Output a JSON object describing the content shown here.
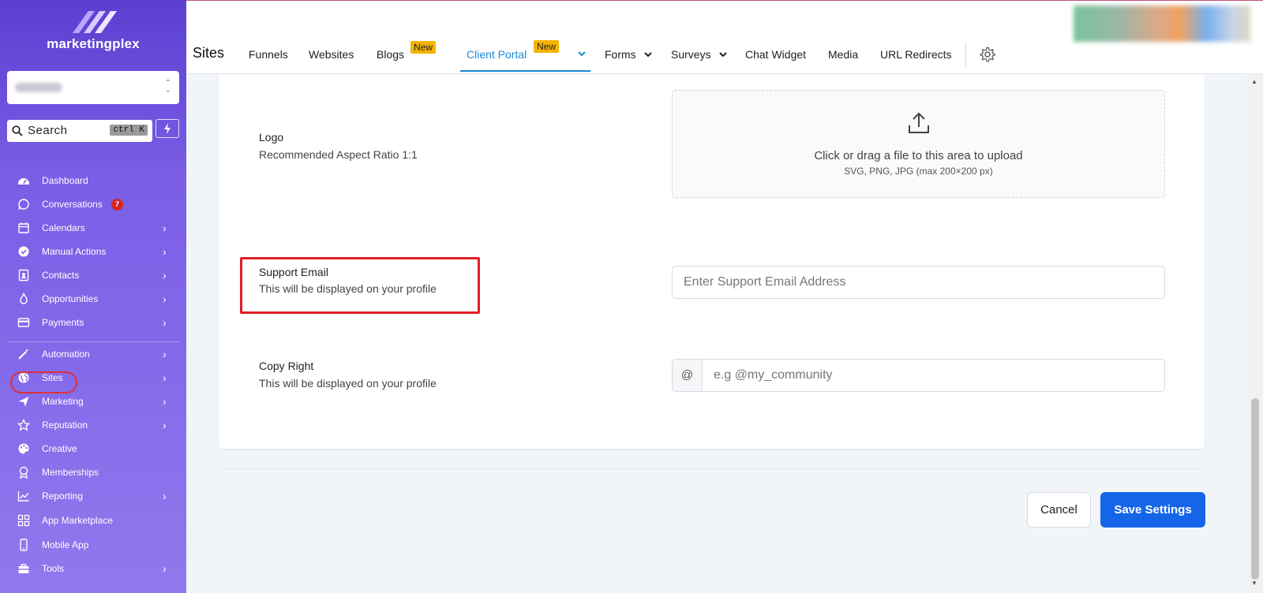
{
  "brand": {
    "name": "marketingplex"
  },
  "search": {
    "label": "Search",
    "shortcut": "ctrl K"
  },
  "sidebar": {
    "items": [
      {
        "label": "Dashboard",
        "icon": "dashboard-icon"
      },
      {
        "label": "Conversations",
        "icon": "chat-icon",
        "badge": "7"
      },
      {
        "label": "Calendars",
        "icon": "calendar-icon"
      },
      {
        "label": "Manual Actions",
        "icon": "check-circle-icon"
      },
      {
        "label": "Contacts",
        "icon": "contact-card-icon"
      },
      {
        "label": "Opportunities",
        "icon": "flame-icon"
      },
      {
        "label": "Payments",
        "icon": "credit-card-icon"
      },
      {
        "label": "Automation",
        "icon": "magic-wand-icon"
      },
      {
        "label": "Sites",
        "icon": "globe-icon"
      },
      {
        "label": "Marketing",
        "icon": "send-icon"
      },
      {
        "label": "Reputation",
        "icon": "star-icon"
      },
      {
        "label": "Creative",
        "icon": "palette-icon"
      },
      {
        "label": "Memberships",
        "icon": "award-icon"
      },
      {
        "label": "Reporting",
        "icon": "chart-icon"
      },
      {
        "label": "App Marketplace",
        "icon": "grid-icon"
      },
      {
        "label": "Mobile App",
        "icon": "mobile-icon"
      },
      {
        "label": "Tools",
        "icon": "toolbox-icon"
      }
    ]
  },
  "topbar": {
    "title": "Sites",
    "tabs": [
      {
        "label": "Funnels"
      },
      {
        "label": "Websites"
      },
      {
        "label": "Blogs",
        "badge": "New"
      },
      {
        "label": "Client Portal",
        "badge": "New",
        "active": true
      },
      {
        "label": "Forms"
      },
      {
        "label": "Surveys"
      },
      {
        "label": "Chat Widget"
      },
      {
        "label": "Media"
      },
      {
        "label": "URL Redirects"
      }
    ]
  },
  "form": {
    "logo": {
      "title": "Logo",
      "subtitle": "Recommended Aspect Ratio 1:1",
      "upload_title": "Click or drag a file to this area to upload",
      "upload_sub": "SVG, PNG, JPG (max 200×200 px)"
    },
    "support_email": {
      "title": "Support Email",
      "subtitle": "This will be displayed on your profile",
      "placeholder": "Enter Support Email Address",
      "value": ""
    },
    "copyright": {
      "title": "Copy Right",
      "subtitle": "This will be displayed on your profile",
      "prefix": "@",
      "placeholder": "e.g @my_community",
      "value": ""
    }
  },
  "actions": {
    "cancel": "Cancel",
    "save": "Save Settings"
  },
  "colors": {
    "primary": "#1565e8",
    "accent": "#1a8ad4",
    "sidebar": "#7a5ee6",
    "highlight": "#e21e26",
    "new_badge": "#f4b400"
  }
}
